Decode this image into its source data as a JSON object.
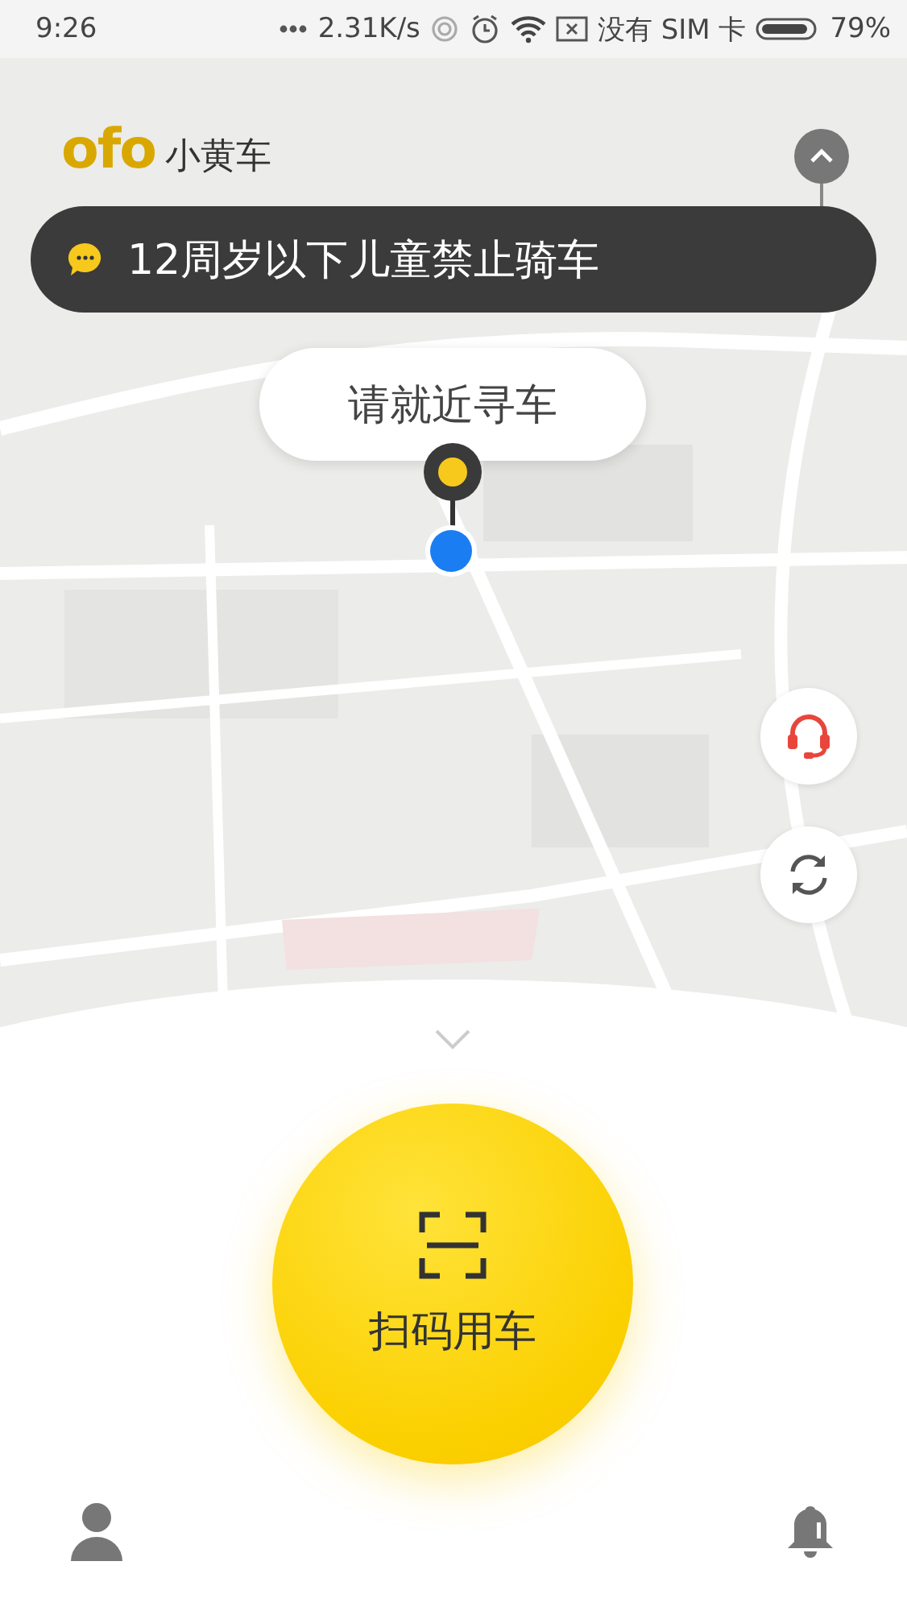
{
  "status_bar": {
    "time": "9:26",
    "network_speed": "2.31K/s",
    "carrier": "没有 SIM 卡",
    "battery": "79%"
  },
  "header": {
    "logo": "ofo",
    "app_name": "小黄车"
  },
  "notice": {
    "text": "12周岁以下儿童禁止骑车"
  },
  "map_callout": {
    "text": "请就近寻车"
  },
  "scan_button": {
    "label": "扫码用车"
  }
}
